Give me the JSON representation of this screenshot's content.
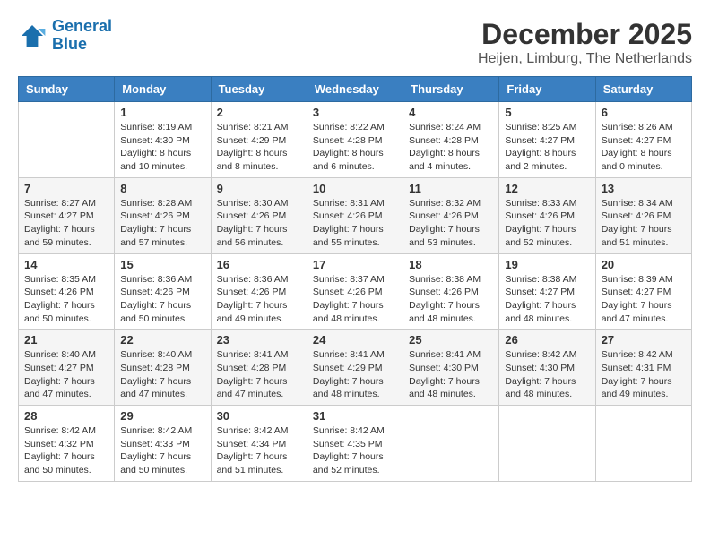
{
  "header": {
    "logo_line1": "General",
    "logo_line2": "Blue",
    "month": "December 2025",
    "location": "Heijen, Limburg, The Netherlands"
  },
  "days_of_week": [
    "Sunday",
    "Monday",
    "Tuesday",
    "Wednesday",
    "Thursday",
    "Friday",
    "Saturday"
  ],
  "weeks": [
    [
      {
        "day": "",
        "sunrise": "",
        "sunset": "",
        "daylight": ""
      },
      {
        "day": "1",
        "sunrise": "Sunrise: 8:19 AM",
        "sunset": "Sunset: 4:30 PM",
        "daylight": "Daylight: 8 hours and 10 minutes."
      },
      {
        "day": "2",
        "sunrise": "Sunrise: 8:21 AM",
        "sunset": "Sunset: 4:29 PM",
        "daylight": "Daylight: 8 hours and 8 minutes."
      },
      {
        "day": "3",
        "sunrise": "Sunrise: 8:22 AM",
        "sunset": "Sunset: 4:28 PM",
        "daylight": "Daylight: 8 hours and 6 minutes."
      },
      {
        "day": "4",
        "sunrise": "Sunrise: 8:24 AM",
        "sunset": "Sunset: 4:28 PM",
        "daylight": "Daylight: 8 hours and 4 minutes."
      },
      {
        "day": "5",
        "sunrise": "Sunrise: 8:25 AM",
        "sunset": "Sunset: 4:27 PM",
        "daylight": "Daylight: 8 hours and 2 minutes."
      },
      {
        "day": "6",
        "sunrise": "Sunrise: 8:26 AM",
        "sunset": "Sunset: 4:27 PM",
        "daylight": "Daylight: 8 hours and 0 minutes."
      }
    ],
    [
      {
        "day": "7",
        "sunrise": "Sunrise: 8:27 AM",
        "sunset": "Sunset: 4:27 PM",
        "daylight": "Daylight: 7 hours and 59 minutes."
      },
      {
        "day": "8",
        "sunrise": "Sunrise: 8:28 AM",
        "sunset": "Sunset: 4:26 PM",
        "daylight": "Daylight: 7 hours and 57 minutes."
      },
      {
        "day": "9",
        "sunrise": "Sunrise: 8:30 AM",
        "sunset": "Sunset: 4:26 PM",
        "daylight": "Daylight: 7 hours and 56 minutes."
      },
      {
        "day": "10",
        "sunrise": "Sunrise: 8:31 AM",
        "sunset": "Sunset: 4:26 PM",
        "daylight": "Daylight: 7 hours and 55 minutes."
      },
      {
        "day": "11",
        "sunrise": "Sunrise: 8:32 AM",
        "sunset": "Sunset: 4:26 PM",
        "daylight": "Daylight: 7 hours and 53 minutes."
      },
      {
        "day": "12",
        "sunrise": "Sunrise: 8:33 AM",
        "sunset": "Sunset: 4:26 PM",
        "daylight": "Daylight: 7 hours and 52 minutes."
      },
      {
        "day": "13",
        "sunrise": "Sunrise: 8:34 AM",
        "sunset": "Sunset: 4:26 PM",
        "daylight": "Daylight: 7 hours and 51 minutes."
      }
    ],
    [
      {
        "day": "14",
        "sunrise": "Sunrise: 8:35 AM",
        "sunset": "Sunset: 4:26 PM",
        "daylight": "Daylight: 7 hours and 50 minutes."
      },
      {
        "day": "15",
        "sunrise": "Sunrise: 8:36 AM",
        "sunset": "Sunset: 4:26 PM",
        "daylight": "Daylight: 7 hours and 50 minutes."
      },
      {
        "day": "16",
        "sunrise": "Sunrise: 8:36 AM",
        "sunset": "Sunset: 4:26 PM",
        "daylight": "Daylight: 7 hours and 49 minutes."
      },
      {
        "day": "17",
        "sunrise": "Sunrise: 8:37 AM",
        "sunset": "Sunset: 4:26 PM",
        "daylight": "Daylight: 7 hours and 48 minutes."
      },
      {
        "day": "18",
        "sunrise": "Sunrise: 8:38 AM",
        "sunset": "Sunset: 4:26 PM",
        "daylight": "Daylight: 7 hours and 48 minutes."
      },
      {
        "day": "19",
        "sunrise": "Sunrise: 8:38 AM",
        "sunset": "Sunset: 4:27 PM",
        "daylight": "Daylight: 7 hours and 48 minutes."
      },
      {
        "day": "20",
        "sunrise": "Sunrise: 8:39 AM",
        "sunset": "Sunset: 4:27 PM",
        "daylight": "Daylight: 7 hours and 47 minutes."
      }
    ],
    [
      {
        "day": "21",
        "sunrise": "Sunrise: 8:40 AM",
        "sunset": "Sunset: 4:27 PM",
        "daylight": "Daylight: 7 hours and 47 minutes."
      },
      {
        "day": "22",
        "sunrise": "Sunrise: 8:40 AM",
        "sunset": "Sunset: 4:28 PM",
        "daylight": "Daylight: 7 hours and 47 minutes."
      },
      {
        "day": "23",
        "sunrise": "Sunrise: 8:41 AM",
        "sunset": "Sunset: 4:28 PM",
        "daylight": "Daylight: 7 hours and 47 minutes."
      },
      {
        "day": "24",
        "sunrise": "Sunrise: 8:41 AM",
        "sunset": "Sunset: 4:29 PM",
        "daylight": "Daylight: 7 hours and 48 minutes."
      },
      {
        "day": "25",
        "sunrise": "Sunrise: 8:41 AM",
        "sunset": "Sunset: 4:30 PM",
        "daylight": "Daylight: 7 hours and 48 minutes."
      },
      {
        "day": "26",
        "sunrise": "Sunrise: 8:42 AM",
        "sunset": "Sunset: 4:30 PM",
        "daylight": "Daylight: 7 hours and 48 minutes."
      },
      {
        "day": "27",
        "sunrise": "Sunrise: 8:42 AM",
        "sunset": "Sunset: 4:31 PM",
        "daylight": "Daylight: 7 hours and 49 minutes."
      }
    ],
    [
      {
        "day": "28",
        "sunrise": "Sunrise: 8:42 AM",
        "sunset": "Sunset: 4:32 PM",
        "daylight": "Daylight: 7 hours and 50 minutes."
      },
      {
        "day": "29",
        "sunrise": "Sunrise: 8:42 AM",
        "sunset": "Sunset: 4:33 PM",
        "daylight": "Daylight: 7 hours and 50 minutes."
      },
      {
        "day": "30",
        "sunrise": "Sunrise: 8:42 AM",
        "sunset": "Sunset: 4:34 PM",
        "daylight": "Daylight: 7 hours and 51 minutes."
      },
      {
        "day": "31",
        "sunrise": "Sunrise: 8:42 AM",
        "sunset": "Sunset: 4:35 PM",
        "daylight": "Daylight: 7 hours and 52 minutes."
      },
      {
        "day": "",
        "sunrise": "",
        "sunset": "",
        "daylight": ""
      },
      {
        "day": "",
        "sunrise": "",
        "sunset": "",
        "daylight": ""
      },
      {
        "day": "",
        "sunrise": "",
        "sunset": "",
        "daylight": ""
      }
    ]
  ]
}
